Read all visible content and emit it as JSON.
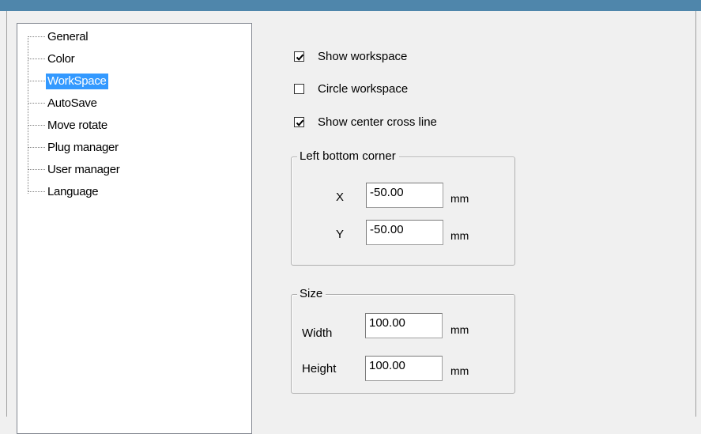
{
  "tree": {
    "items": [
      {
        "label": "General",
        "selected": false
      },
      {
        "label": "Color",
        "selected": false
      },
      {
        "label": "WorkSpace",
        "selected": true
      },
      {
        "label": "AutoSave",
        "selected": false
      },
      {
        "label": "Move rotate",
        "selected": false
      },
      {
        "label": "Plug manager",
        "selected": false
      },
      {
        "label": "User manager",
        "selected": false
      },
      {
        "label": "Language",
        "selected": false
      }
    ]
  },
  "options": {
    "show_workspace": {
      "label": "Show workspace",
      "checked": true
    },
    "circle_workspace": {
      "label": "Circle workspace",
      "checked": false
    },
    "show_center_cross": {
      "label": "Show center cross line",
      "checked": true
    }
  },
  "left_bottom_corner": {
    "title": "Left bottom corner",
    "x_label": "X",
    "x_value": "-50.00",
    "x_unit": "mm",
    "y_label": "Y",
    "y_value": "-50.00",
    "y_unit": "mm"
  },
  "size": {
    "title": "Size",
    "width_label": "Width",
    "width_value": "100.00",
    "width_unit": "mm",
    "height_label": "Height",
    "height_value": "100.00",
    "height_unit": "mm"
  },
  "colors": {
    "selection": "#3399ff",
    "titlebar": "#4f86ab"
  }
}
